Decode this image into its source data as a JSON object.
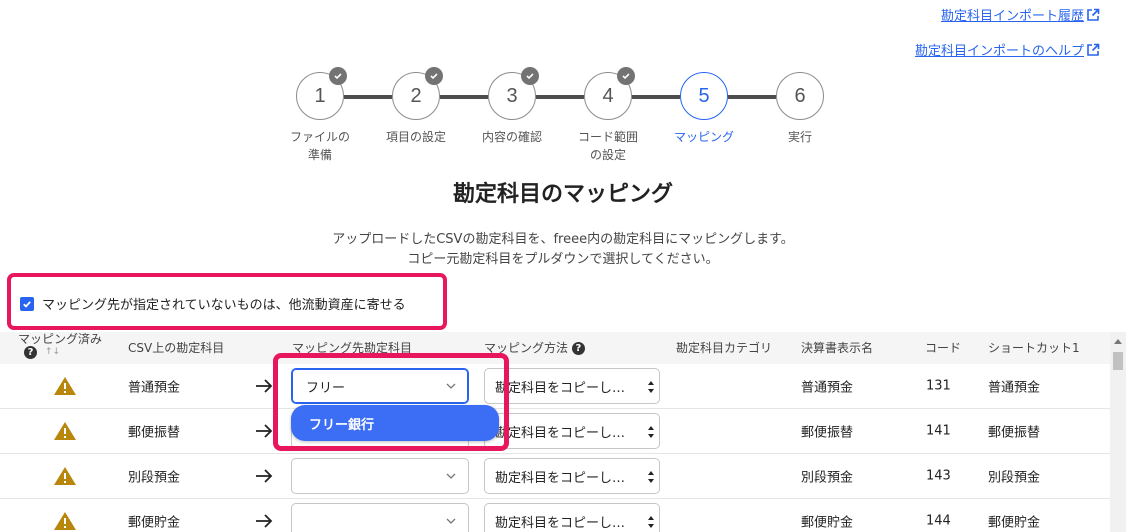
{
  "top_links": {
    "history": "勘定科目インポート履歴",
    "help": "勘定科目インポートのヘルプ"
  },
  "stepper": {
    "steps": [
      {
        "number": "1",
        "label": "ファイルの\n準備",
        "done": true
      },
      {
        "number": "2",
        "label": "項目の設定",
        "done": true
      },
      {
        "number": "3",
        "label": "内容の確認",
        "done": true
      },
      {
        "number": "4",
        "label": "コード範囲\nの設定",
        "done": true
      },
      {
        "number": "5",
        "label": "マッピング",
        "active": true
      },
      {
        "number": "6",
        "label": "実行"
      }
    ]
  },
  "page": {
    "title": "勘定科目のマッピング",
    "description_line1": "アップロードしたCSVの勘定科目を、freee内の勘定科目にマッピングします。",
    "description_line2": "コピー元勘定科目をプルダウンで選択してください。"
  },
  "fallback_option": {
    "checked": true,
    "label": "マッピング先が指定されていないものは、他流動資産に寄せる"
  },
  "table": {
    "headers": {
      "mapped": "マッピング済み",
      "sort_marker": "↑↓",
      "csv_account": "CSV上の勘定科目",
      "target_account": "マッピング先勘定科目",
      "method": "マッピング方法",
      "category": "勘定科目カテゴリ",
      "statement_name": "決算書表示名",
      "code": "コード",
      "shortcut": "ショートカット1"
    },
    "rows": [
      {
        "csv_account": "普通預金",
        "target": "フリー",
        "method": "勘定科目をコピーし…",
        "category": "",
        "statement_name": "普通預金",
        "code": "131",
        "shortcut": "普通預金"
      },
      {
        "csv_account": "郵便振替",
        "target": "",
        "method": "勘定科目をコピーし…",
        "category": "",
        "statement_name": "郵便振替",
        "code": "141",
        "shortcut": "郵便振替"
      },
      {
        "csv_account": "別段預金",
        "target": "",
        "method": "勘定科目をコピーし…",
        "category": "",
        "statement_name": "別段預金",
        "code": "143",
        "shortcut": "別段預金"
      },
      {
        "csv_account": "郵便貯金",
        "target": "",
        "method": "勘定科目をコピーし…",
        "category": "",
        "statement_name": "郵便貯金",
        "code": "144",
        "shortcut": "郵便貯金"
      }
    ]
  },
  "dropdown": {
    "option": "フリー銀行"
  },
  "colors": {
    "accent": "#2864f0",
    "highlight": "#e8175d",
    "warning": "#b8860b"
  }
}
